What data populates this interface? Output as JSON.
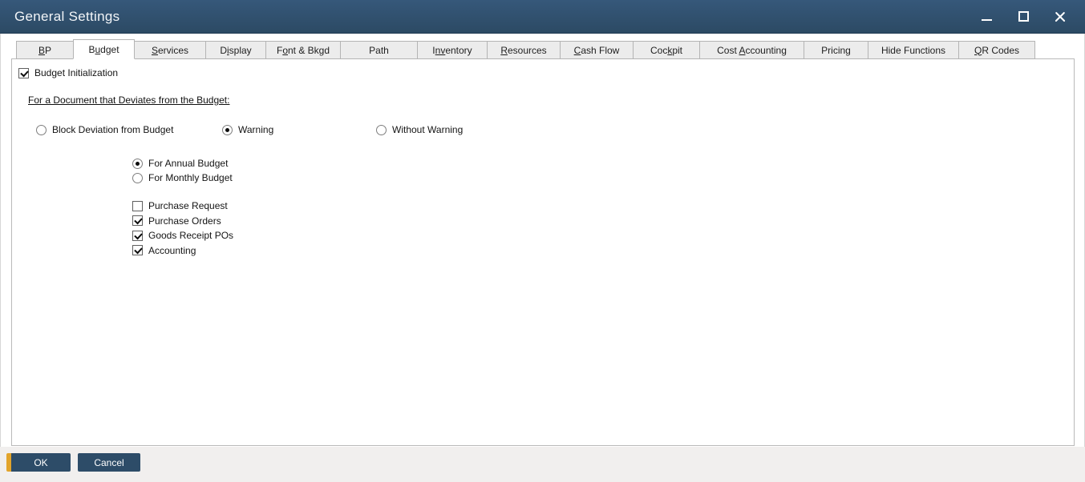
{
  "colors": {
    "titlebar": "#2c4a64",
    "titlebar_top": "#36587a",
    "button": "#2d4c68",
    "accent": "#e2a42b"
  },
  "window": {
    "title": "General Settings",
    "icons": {
      "minimize": "minimize-bar",
      "maximize": "square-outline",
      "close": "x-cross"
    }
  },
  "tabs": [
    {
      "pre": "",
      "mn": "B",
      "post": "P",
      "active": false
    },
    {
      "pre": "B",
      "mn": "u",
      "post": "dget",
      "active": true
    },
    {
      "pre": "",
      "mn": "S",
      "post": "ervices",
      "active": false
    },
    {
      "pre": "D",
      "mn": "i",
      "post": "splay",
      "active": false
    },
    {
      "pre": "F",
      "mn": "o",
      "post": "nt & Bkgd",
      "active": false
    },
    {
      "pre": "Path",
      "mn": "",
      "post": "",
      "active": false
    },
    {
      "pre": "I",
      "mn": "nv",
      "post": "entory",
      "active": false
    },
    {
      "pre": "",
      "mn": "R",
      "post": "esources",
      "active": false
    },
    {
      "pre": "",
      "mn": "C",
      "post": "ash Flow",
      "active": false
    },
    {
      "pre": "Coc",
      "mn": "k",
      "post": "pit",
      "active": false
    },
    {
      "pre": "Cost ",
      "mn": "A",
      "post": "ccounting",
      "active": false
    },
    {
      "pre": "Pricing",
      "mn": "",
      "post": "",
      "active": false
    },
    {
      "pre": "Hide Functions",
      "mn": "",
      "post": "",
      "active": false
    },
    {
      "pre": "",
      "mn": "Q",
      "post": "R Codes",
      "active": false
    }
  ],
  "content": {
    "budget_init": {
      "label": "Budget Initialization",
      "checked": true
    },
    "deviation_heading": "For a Document that Deviates from the Budget:",
    "deviation_options": [
      {
        "label": "Block Deviation from Budget",
        "selected": false
      },
      {
        "label": "Warning",
        "selected": true
      },
      {
        "label": "Without Warning",
        "selected": false
      }
    ],
    "budget_period_options": [
      {
        "label": "For Annual Budget",
        "selected": true
      },
      {
        "label": "For Monthly Budget",
        "selected": false
      }
    ],
    "document_types": [
      {
        "label": "Purchase Request",
        "checked": false
      },
      {
        "label": "Purchase Orders",
        "checked": true
      },
      {
        "label": "Goods Receipt POs",
        "checked": true
      },
      {
        "label": "Accounting",
        "checked": true
      }
    ]
  },
  "footer": {
    "ok_label": "OK",
    "cancel_label": "Cancel"
  }
}
